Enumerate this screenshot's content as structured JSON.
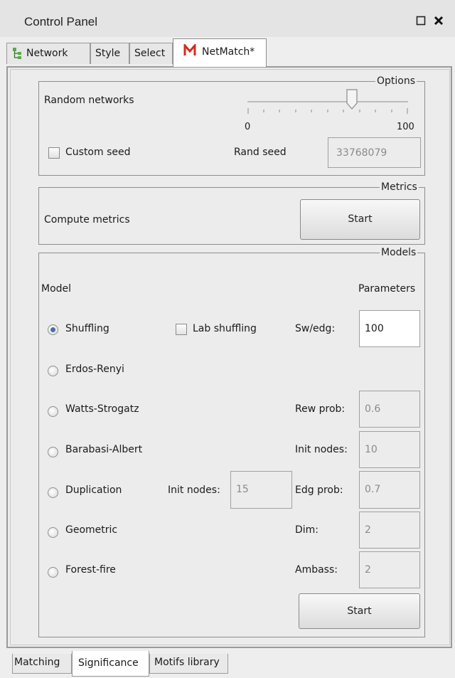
{
  "window": {
    "title": "Control Panel"
  },
  "icons": {
    "float": "square-icon",
    "close": "close-x-icon",
    "network": "network-tree-icon",
    "netmatch": "netmatch-logo-icon"
  },
  "tabs": [
    "Network",
    "Style",
    "Select",
    "NetMatch*"
  ],
  "options": {
    "legend": "Options",
    "random_networks_label": "Random networks",
    "slider": {
      "min": "0",
      "max": "100",
      "value": 65
    },
    "custom_seed_label": "Custom seed",
    "rand_seed_label": "Rand seed",
    "rand_seed_value": "33768079"
  },
  "metrics": {
    "legend": "Metrics",
    "label": "Compute metrics",
    "start": "Start"
  },
  "models": {
    "legend": "Models",
    "model_header": "Model",
    "parameters_header": "Parameters",
    "items": [
      {
        "name": "Shuffling",
        "selected": true
      },
      {
        "name": "Erdos-Renyi",
        "selected": false
      },
      {
        "name": "Watts-Strogatz",
        "selected": false
      },
      {
        "name": "Barabasi-Albert",
        "selected": false
      },
      {
        "name": "Duplication",
        "selected": false
      },
      {
        "name": "Geometric",
        "selected": false
      },
      {
        "name": "Forest-fire",
        "selected": false
      }
    ],
    "lab_shuffling_label": "Lab shuffling",
    "params": {
      "sw_edg": {
        "label": "Sw/edg:",
        "value": "100"
      },
      "rew_prob": {
        "label": "Rew prob:",
        "value": "0.6"
      },
      "init_nodes": {
        "label": "Init nodes:",
        "value": "10"
      },
      "dup_init_nodes": {
        "label": "Init nodes:",
        "value": "15"
      },
      "edg_prob": {
        "label": "Edg prob:",
        "value": "0.7"
      },
      "dim": {
        "label": "Dim:",
        "value": "2"
      },
      "ambass": {
        "label": "Ambass:",
        "value": "2"
      }
    },
    "start": "Start"
  },
  "bottom_tabs": [
    "Matching",
    "Significance",
    "Motifs library"
  ]
}
